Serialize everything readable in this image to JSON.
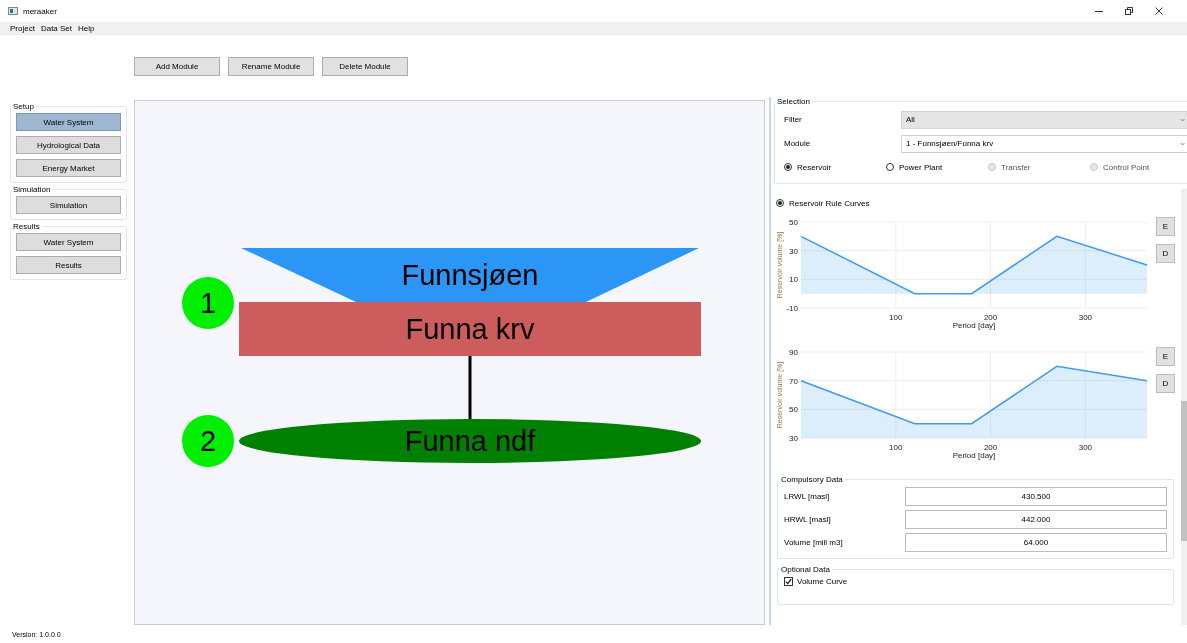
{
  "window": {
    "title": "meraaker"
  },
  "menu": [
    "Project",
    "Data Set",
    "Help"
  ],
  "toolbar": [
    "Add Module",
    "Rename Module",
    "Delete Module"
  ],
  "sidebar": [
    {
      "title": "Setup",
      "items": [
        {
          "label": "Water System",
          "selected": true
        },
        {
          "label": "Hydrological Data",
          "selected": false
        },
        {
          "label": "Energy Market",
          "selected": false
        }
      ]
    },
    {
      "title": "Simulation",
      "items": [
        {
          "label": "Simulation",
          "selected": false
        }
      ]
    },
    {
      "title": "Results",
      "items": [
        {
          "label": "Water System",
          "selected": false
        },
        {
          "label": "Results",
          "selected": false
        }
      ]
    }
  ],
  "diagram": {
    "badges": [
      "1",
      "2"
    ],
    "nodes": [
      {
        "kind": "reservoir",
        "label": "Funnsjøen",
        "color": "#2b96f5"
      },
      {
        "kind": "plant",
        "label": "Funna krv",
        "color": "#cd5c5c"
      },
      {
        "kind": "outlet",
        "label": "Funna ndf",
        "color": "#008000"
      }
    ]
  },
  "selection": {
    "title": "Selection",
    "fields": [
      {
        "label": "Filter",
        "value": "All",
        "disabled": true
      },
      {
        "label": "Module",
        "value": "1 - Funnsjøen/Funna krv",
        "disabled": false
      }
    ],
    "types": [
      {
        "label": "Reservoir",
        "selected": true,
        "disabled": false
      },
      {
        "label": "Power Plant",
        "selected": false,
        "disabled": false
      },
      {
        "label": "Transfer",
        "selected": false,
        "disabled": true
      },
      {
        "label": "Control Point",
        "selected": false,
        "disabled": true
      }
    ]
  },
  "rule_curves": {
    "label": "Reservoir Rule Curves",
    "selected": true,
    "charts": [
      {
        "buttons": [
          "E",
          "D"
        ],
        "chart_data": {
          "type": "area",
          "xlabel": "Period [day]",
          "ylabel": "Reservoir volume [%]",
          "x": [
            0,
            120,
            180,
            270,
            365
          ],
          "series": [
            {
              "color": "#3d9bf0",
              "values": [
                40,
                0,
                0,
                40,
                20
              ]
            }
          ],
          "xlim": [
            0,
            365
          ],
          "ylim": [
            -10,
            50
          ],
          "grid": true,
          "xticks": [
            100,
            200,
            300
          ],
          "yticks": [
            -10,
            10,
            30,
            50
          ]
        }
      },
      {
        "buttons": [
          "E",
          "D"
        ],
        "chart_data": {
          "type": "area",
          "xlabel": "Period [day]",
          "ylabel": "Reservoir volume [%]",
          "x": [
            0,
            120,
            180,
            270,
            365
          ],
          "series": [
            {
              "color": "#3d9bf0",
              "values": [
                70,
                40,
                40,
                80,
                70
              ]
            }
          ],
          "xlim": [
            0,
            365
          ],
          "ylim": [
            30,
            90
          ],
          "grid": true,
          "xticks": [
            100,
            200,
            300
          ],
          "yticks": [
            30,
            50,
            70,
            90
          ]
        }
      }
    ]
  },
  "compulsory": {
    "title": "Compulsory Data",
    "fields": [
      {
        "label": "LRWL [masl]",
        "value": "430.500"
      },
      {
        "label": "HRWL [masl]",
        "value": "442.000"
      },
      {
        "label": "Volume [mill m3]",
        "value": "64.000"
      }
    ]
  },
  "optional": {
    "title": "Optional Data",
    "items": [
      {
        "label": "Volume Curve",
        "checked": true
      }
    ]
  },
  "footer": {
    "version": "Version: 1.0.0.0"
  }
}
